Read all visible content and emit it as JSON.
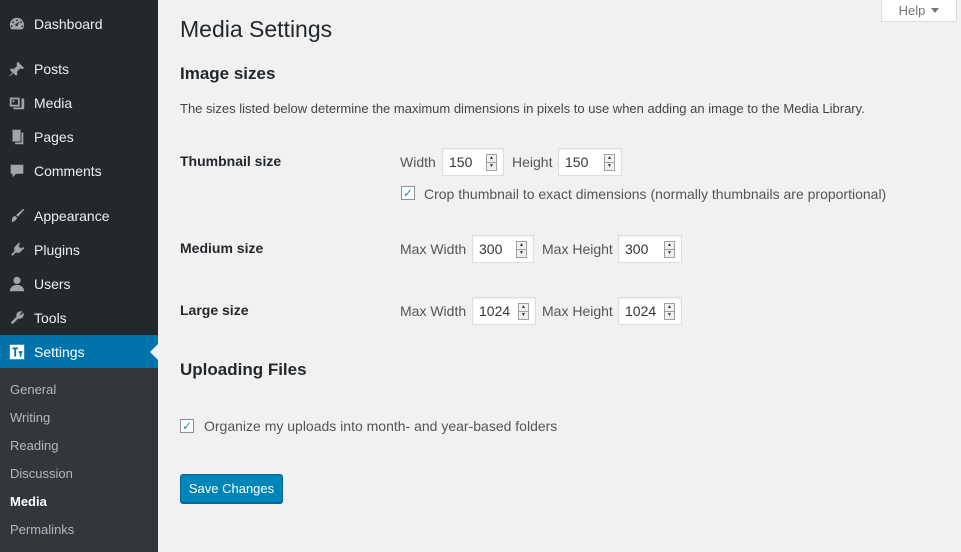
{
  "sidebar": {
    "items": [
      {
        "label": "Dashboard",
        "icon": "dashboard-icon"
      },
      {
        "label": "Posts",
        "icon": "pushpin-icon"
      },
      {
        "label": "Media",
        "icon": "media-icon"
      },
      {
        "label": "Pages",
        "icon": "pages-icon"
      },
      {
        "label": "Comments",
        "icon": "comment-icon"
      },
      {
        "label": "Appearance",
        "icon": "paintbrush-icon"
      },
      {
        "label": "Plugins",
        "icon": "plugin-icon"
      },
      {
        "label": "Users",
        "icon": "user-icon"
      },
      {
        "label": "Tools",
        "icon": "wrench-icon"
      },
      {
        "label": "Settings",
        "icon": "settings-icon",
        "current": true
      }
    ],
    "submenu": [
      {
        "label": "General"
      },
      {
        "label": "Writing"
      },
      {
        "label": "Reading"
      },
      {
        "label": "Discussion"
      },
      {
        "label": "Media",
        "current": true
      },
      {
        "label": "Permalinks"
      }
    ]
  },
  "help": {
    "label": "Help"
  },
  "page": {
    "title": "Media Settings",
    "image_sizes": {
      "heading": "Image sizes",
      "description": "The sizes listed below determine the maximum dimensions in pixels to use when adding an image to the Media Library.",
      "thumbnail": {
        "label": "Thumbnail size",
        "width_label": "Width",
        "width_value": "150",
        "height_label": "Height",
        "height_value": "150",
        "crop_label": "Crop thumbnail to exact dimensions (normally thumbnails are proportional)",
        "crop_checked": true
      },
      "medium": {
        "label": "Medium size",
        "max_width_label": "Max Width",
        "max_width_value": "300",
        "max_height_label": "Max Height",
        "max_height_value": "300"
      },
      "large": {
        "label": "Large size",
        "max_width_label": "Max Width",
        "max_width_value": "1024",
        "max_height_label": "Max Height",
        "max_height_value": "1024"
      }
    },
    "uploading": {
      "heading": "Uploading Files",
      "organize_label": "Organize my uploads into month- and year-based folders",
      "organize_checked": true
    },
    "save_label": "Save Changes"
  },
  "colors": {
    "sidebar_bg": "#23282d",
    "submenu_bg": "#32373c",
    "accent": "#0073aa",
    "button": "#0085ba",
    "page_bg": "#f1f1f1"
  }
}
